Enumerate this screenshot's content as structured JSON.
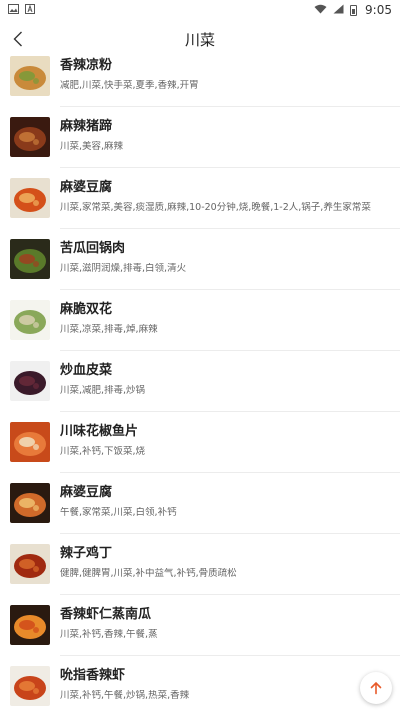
{
  "status_bar": {
    "time": "9:05"
  },
  "header": {
    "title": "川菜"
  },
  "recipes": [
    {
      "title": "香辣凉粉",
      "tags": "减肥,川菜,快手菜,夏季,香辣,开胃",
      "colors": [
        "#e9dcc0",
        "#c98a3a",
        "#7a9a3a"
      ]
    },
    {
      "title": "麻辣猪蹄",
      "tags": "川菜,美容,麻辣",
      "colors": [
        "#3a1a10",
        "#8a3a1a",
        "#c87a3a"
      ]
    },
    {
      "title": "麻婆豆腐",
      "tags": "川菜,家常菜,美容,痰湿质,麻辣,10-20分钟,烧,晚餐,1-2人,锅子,养生家常菜",
      "colors": [
        "#e8e0d0",
        "#d4501a",
        "#f0b060"
      ]
    },
    {
      "title": "苦瓜回锅肉",
      "tags": "川菜,滋阴润燥,排毒,白领,清火",
      "colors": [
        "#2a2a1a",
        "#5a7a2a",
        "#a04020"
      ]
    },
    {
      "title": "麻脆双花",
      "tags": "川菜,凉菜,排毒,焯,麻辣",
      "colors": [
        "#f4f4ee",
        "#8aa85a",
        "#d8d0b0"
      ]
    },
    {
      "title": "炒血皮菜",
      "tags": "川菜,减肥,排毒,炒锅",
      "colors": [
        "#f0f0f0",
        "#3a1a2a",
        "#6a2a3a"
      ]
    },
    {
      "title": "川味花椒鱼片",
      "tags": "川菜,补钙,下饭菜,烧",
      "colors": [
        "#c84a1a",
        "#e87a3a",
        "#f0e0c0"
      ]
    },
    {
      "title": "麻婆豆腐",
      "tags": "午餐,家常菜,川菜,白领,补钙",
      "colors": [
        "#2a1a10",
        "#d06a2a",
        "#f0c070"
      ]
    },
    {
      "title": "辣子鸡丁",
      "tags": "健脾,健脾胃,川菜,补中益气,补钙,骨质疏松",
      "colors": [
        "#e8e0d0",
        "#a02a10",
        "#d86a2a"
      ]
    },
    {
      "title": "香辣虾仁蒸南瓜",
      "tags": "川菜,补钙,香辣,午餐,蒸",
      "colors": [
        "#2a1a10",
        "#e88a2a",
        "#d04a1a"
      ]
    },
    {
      "title": "吮指香辣虾",
      "tags": "川菜,补钙,午餐,炒锅,热菜,香辣",
      "colors": [
        "#f0ece4",
        "#c8441a",
        "#e8803a"
      ]
    }
  ],
  "theme": {
    "accent": "#e85a2a",
    "divider": "#ececec"
  }
}
